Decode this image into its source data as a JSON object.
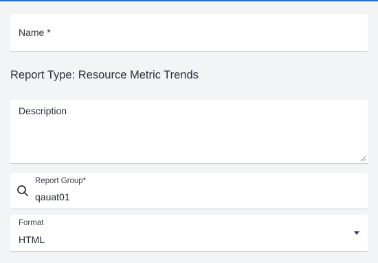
{
  "form": {
    "name_field": {
      "label": "Name *"
    },
    "report_type": "Report Type: Resource Metric Trends",
    "description_field": {
      "label": "Description"
    },
    "report_group_field": {
      "label": "Report Group*",
      "value": "qauat01",
      "icon": "search-icon"
    },
    "format_field": {
      "label": "Format",
      "value": "HTML",
      "icon": "dropdown-caret-icon"
    }
  },
  "colors": {
    "accent": "#2d6ccf",
    "caret": "#1e3a8a",
    "field_bg": "#ffffff",
    "page_bg": "#f3f4f6"
  }
}
